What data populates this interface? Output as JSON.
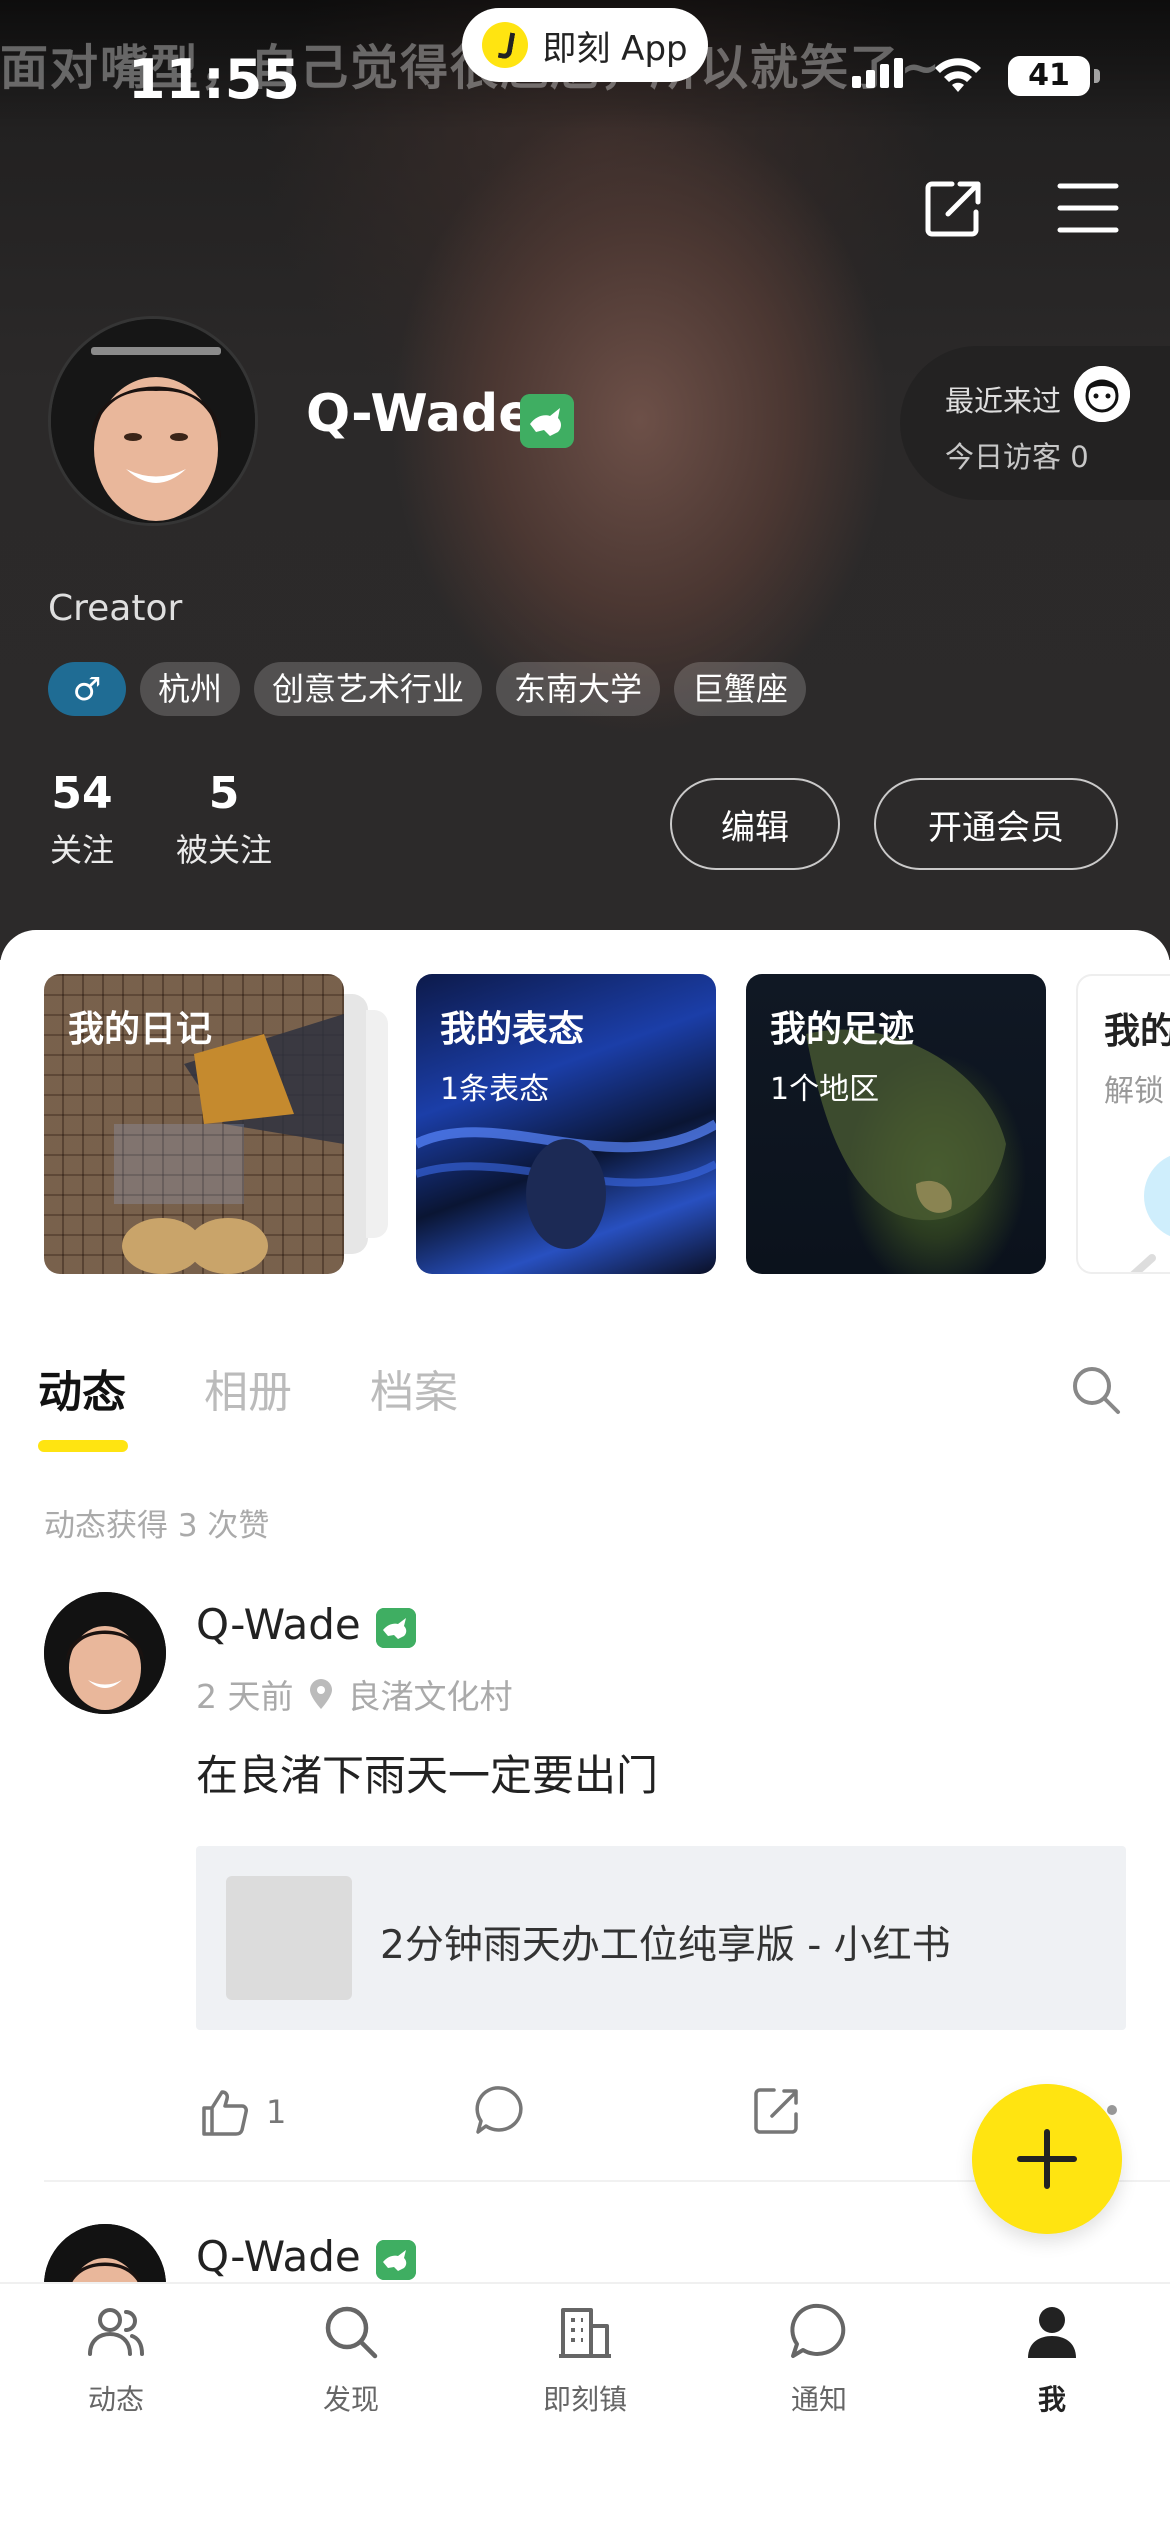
{
  "status_bar": {
    "time": "11:55",
    "battery": "41",
    "app_pill_label": "即刻 App",
    "ticker_text": "面对嘴型，自己觉得很尴尬，所以就笑了~"
  },
  "profile": {
    "username": "Q-Wade",
    "role": "Creator",
    "recent_visitors_label": "最近来过",
    "today_visitors": "今日访客 0",
    "gender_tag": "♂",
    "tags": [
      "杭州",
      "创意艺术行业",
      "东南大学",
      "巨蟹座"
    ],
    "following_count": "54",
    "following_label": "关注",
    "followers_count": "5",
    "followers_label": "被关注",
    "edit_label": "编辑",
    "vip_label": "开通会员"
  },
  "cards": [
    {
      "title": "我的日记",
      "subtitle": ""
    },
    {
      "title": "我的表态",
      "subtitle": "1条表态"
    },
    {
      "title": "我的足迹",
      "subtitle": "1个地区"
    },
    {
      "title": "我的",
      "subtitle": "解锁"
    }
  ],
  "tabs": {
    "items": [
      "动态",
      "相册",
      "档案"
    ],
    "active": "动态"
  },
  "feed": {
    "likes_summary": "动态获得 3 次赞",
    "posts": [
      {
        "author": "Q-Wade",
        "time": "2 天前",
        "location": "良渚文化村",
        "text": "在良渚下雨天一定要出门",
        "link_title": "2分钟雨天办工位纯享版 - 小红书",
        "like_count": "1"
      },
      {
        "author": "Q-Wade"
      }
    ]
  },
  "bottom_nav": [
    {
      "label": "动态",
      "icon": "people-icon"
    },
    {
      "label": "发现",
      "icon": "search-icon"
    },
    {
      "label": "即刻镇",
      "icon": "building-icon"
    },
    {
      "label": "通知",
      "icon": "chat-bubble-icon"
    },
    {
      "label": "我",
      "icon": "person-icon"
    }
  ],
  "colors": {
    "accent_yellow": "#ffe411",
    "badge_green": "#3fae62",
    "gender_blue": "#1f6c94"
  }
}
